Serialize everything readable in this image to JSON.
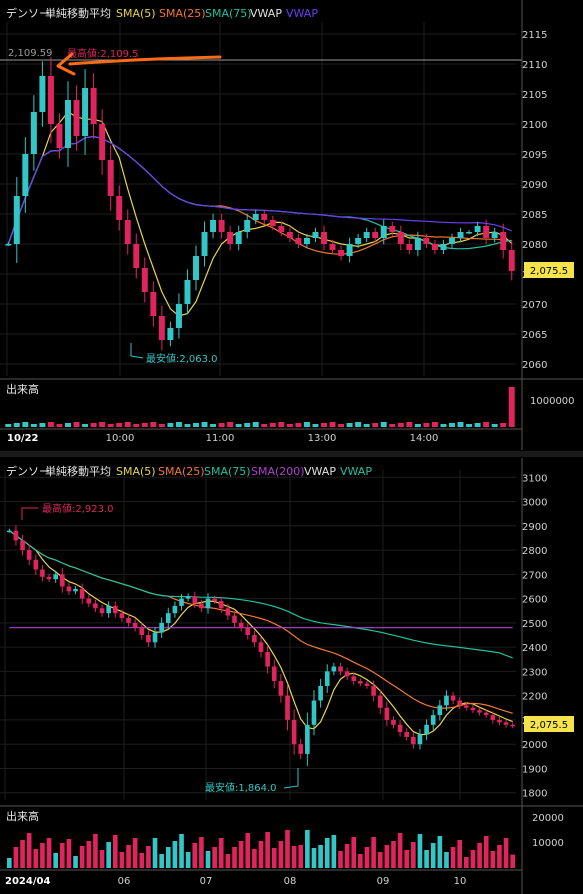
{
  "colors": {
    "background": "#000000",
    "grid": "#1e1e1e",
    "up": "#33c6c6",
    "down": "#e0245e",
    "sma5": "#e8d44a",
    "sma25": "#f07830",
    "sma75": "#20c0a0",
    "sma200": "#b040d0",
    "vwap": "#6a3df0",
    "vwap_lower": "#20c0a0",
    "annotation": "#ff6a14",
    "price_tag_bg": "#f5e34a"
  },
  "top_chart": {
    "legend": {
      "symbol": "デンソー",
      "indicator": "単純移動平均",
      "items": [
        {
          "label": "SMA(5)",
          "color": "#e8d44a"
        },
        {
          "label": "SMA(25)",
          "color": "#f07830"
        },
        {
          "label": "SMA(75)",
          "color": "#20c0a0"
        },
        {
          "label": "VWAP",
          "color": "#e0e0e0"
        },
        {
          "label": "VWAP",
          "color": "#6a3df0"
        }
      ]
    },
    "reference_price": "2,109.59",
    "high_label": "最高値:2,109.5",
    "low_label": "最安値:2,063.0",
    "last_price": "2,075.5",
    "volume_title": "出来高",
    "volume_tick": "1000000",
    "date_label": "10/22"
  },
  "bottom_chart": {
    "legend": {
      "symbol": "デンソー",
      "indicator": "単純移動平均",
      "items": [
        {
          "label": "SMA(5)",
          "color": "#e8d44a"
        },
        {
          "label": "SMA(25)",
          "color": "#f07830"
        },
        {
          "label": "SMA(75)",
          "color": "#20c0a0"
        },
        {
          "label": "SMA(200)",
          "color": "#b040d0"
        },
        {
          "label": "VWAP",
          "color": "#e0e0e0"
        },
        {
          "label": "VWAP",
          "color": "#20c0a0"
        }
      ]
    },
    "high_label": "最高値:2,923.0",
    "low_label": "最安値:1,864.0",
    "last_price": "2,075.5",
    "volume_title": "出来高",
    "volume_ticks": [
      "20000",
      "10000"
    ]
  },
  "chart_data": [
    {
      "type": "candlestick",
      "title": "デンソー 単純移動平均 (intraday 10/22)",
      "x_labels": [
        "10/22",
        "10:00",
        "11:00",
        "13:00",
        "14:00"
      ],
      "y_ticks": [
        2060,
        2065,
        2070,
        2075,
        2080,
        2085,
        2090,
        2095,
        2100,
        2105,
        2110,
        2115
      ],
      "ylim": [
        2058,
        2117
      ],
      "high": 2109.5,
      "low": 2063.0,
      "last": 2075.5,
      "close_path": [
        2080,
        2088,
        2095,
        2102,
        2108,
        2100,
        2096,
        2104,
        2098,
        2106,
        2100,
        2094,
        2088,
        2084,
        2080,
        2076,
        2072,
        2068,
        2064,
        2066,
        2070,
        2074,
        2078,
        2082,
        2084,
        2082,
        2080,
        2082,
        2084,
        2085,
        2084,
        2083,
        2082,
        2081,
        2080,
        2081,
        2082,
        2080,
        2079,
        2078,
        2080,
        2081,
        2082,
        2081,
        2083,
        2082,
        2080,
        2079,
        2081,
        2080,
        2079,
        2080,
        2081,
        2082,
        2082,
        2083,
        2081,
        2082,
        2079,
        2075.5
      ],
      "series": [
        {
          "name": "SMA(5)"
        },
        {
          "name": "SMA(25)"
        },
        {
          "name": "SMA(75)"
        },
        {
          "name": "VWAP"
        }
      ],
      "volume_tick": 1000000,
      "grid": true
    },
    {
      "type": "candlestick",
      "title": "デンソー 単純移動平均 (daily)",
      "x_labels": [
        "2024/04",
        "06",
        "07",
        "08",
        "09",
        "10"
      ],
      "y_ticks": [
        1800,
        1900,
        2000,
        2100,
        2200,
        2300,
        2400,
        2500,
        2600,
        2700,
        2800,
        2900,
        3000,
        3100
      ],
      "ylim": [
        1770,
        3130
      ],
      "high": 2923.0,
      "low": 1864.0,
      "last": 2075.5,
      "close_path": [
        2880,
        2840,
        2800,
        2760,
        2720,
        2690,
        2680,
        2700,
        2650,
        2630,
        2640,
        2600,
        2580,
        2560,
        2540,
        2570,
        2540,
        2520,
        2500,
        2480,
        2450,
        2420,
        2460,
        2500,
        2540,
        2570,
        2600,
        2610,
        2580,
        2560,
        2600,
        2590,
        2560,
        2530,
        2500,
        2480,
        2450,
        2420,
        2380,
        2320,
        2260,
        2200,
        2100,
        2000,
        1960,
        2080,
        2180,
        2240,
        2300,
        2320,
        2300,
        2280,
        2260,
        2250,
        2240,
        2200,
        2150,
        2100,
        2080,
        2050,
        2030,
        2000,
        2040,
        2080,
        2120,
        2160,
        2200,
        2180,
        2160,
        2150,
        2140,
        2130,
        2120,
        2100,
        2090,
        2080,
        2075.5
      ],
      "series": [
        {
          "name": "SMA(5)"
        },
        {
          "name": "SMA(25)"
        },
        {
          "name": "SMA(75)"
        },
        {
          "name": "SMA(200)"
        },
        {
          "name": "VWAP"
        }
      ],
      "volume_ticks": [
        10000,
        20000
      ],
      "grid": true
    }
  ]
}
